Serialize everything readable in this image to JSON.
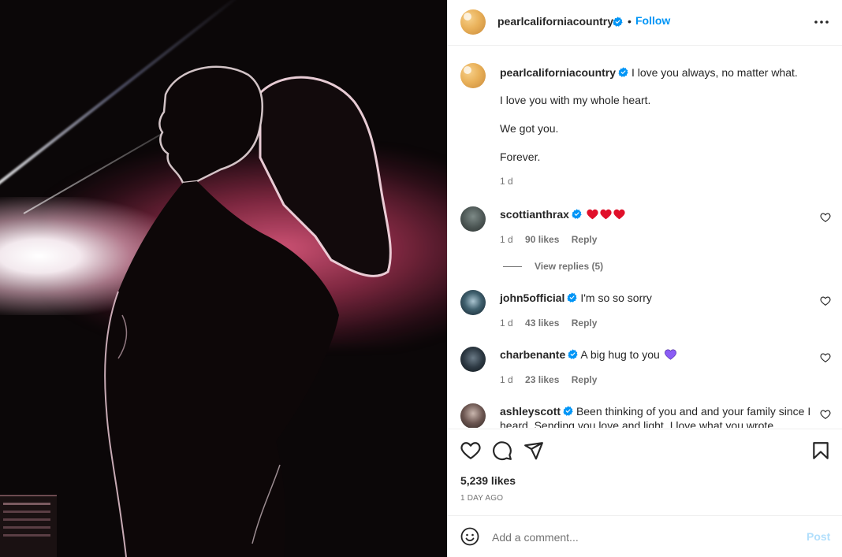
{
  "post": {
    "author": "pearlcaliforniacountry",
    "follow_label": "Follow",
    "separator": "•",
    "caption": {
      "first_line": "I love you always, no matter what.",
      "lines": [
        "I love you with my whole heart.",
        "We got you.",
        "Forever."
      ],
      "time": "1 d"
    }
  },
  "comments": [
    {
      "user": "scottianthrax",
      "text": "",
      "emoji": [
        "red-heart",
        "red-heart",
        "red-heart"
      ],
      "time": "1 d",
      "likes": "90 likes",
      "reply": "Reply",
      "view_replies": "View replies (5)"
    },
    {
      "user": "john5official",
      "text": "I'm so so sorry",
      "time": "1 d",
      "likes": "43 likes",
      "reply": "Reply"
    },
    {
      "user": "charbenante",
      "text": "A big hug to you",
      "emoji": [
        "purple-heart"
      ],
      "time": "1 d",
      "likes": "23 likes",
      "reply": "Reply"
    },
    {
      "user": "ashleyscott",
      "text": "Been thinking of you and and your family since I heard. Sending you love and light. I love what you wrote."
    }
  ],
  "footer": {
    "likes": "5,239 likes",
    "date": "1 DAY AGO",
    "comment_placeholder": "Add a comment...",
    "post_label": "Post"
  },
  "colors": {
    "link_blue": "#0095f6",
    "verified_blue": "#0095f6",
    "post_disabled": "#b2dffc",
    "heart_red": "#e0102a",
    "heart_purple": "#8a5cf5"
  },
  "icons": [
    "more-options-icon",
    "like-icon",
    "comment-icon",
    "share-icon",
    "save-icon",
    "emoji-icon",
    "verified-badge-icon",
    "heart-small-icon"
  ]
}
